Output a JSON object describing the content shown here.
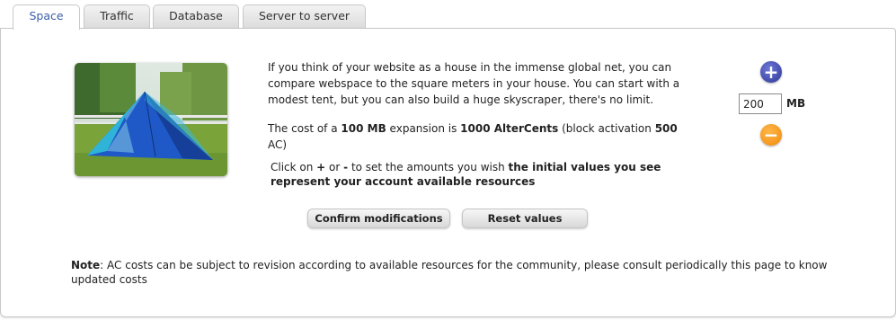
{
  "tabs": [
    {
      "label": "Space",
      "active": true
    },
    {
      "label": "Traffic",
      "active": false
    },
    {
      "label": "Database",
      "active": false
    },
    {
      "label": "Server to server",
      "active": false
    }
  ],
  "image": {
    "subject": "tent-icon"
  },
  "description": "If you think of your website as a house in the immense global net, you can compare webspace to the square meters in your house. You can start with a modest tent, but you can also build a huge skyscraper, there's no limit.",
  "cost": {
    "prefix": "The cost of a ",
    "amount": "100 MB",
    "mid": " expansion is ",
    "price": "1000 AlterCents",
    "block_prefix": " (block activation ",
    "block_value": "500",
    "suffix": "AC)"
  },
  "instructions": {
    "prefix": "Click on ",
    "plus": "+",
    "or": " or ",
    "minus": "-",
    "mid": " to set the amounts you wish ",
    "bold": "the initial values you see represent your account available resources"
  },
  "controls": {
    "plus_symbol": "+",
    "minus_symbol": "−",
    "value": "200",
    "unit": "MB"
  },
  "buttons": {
    "confirm": "Confirm modifications",
    "reset": "Reset values"
  },
  "note": {
    "label": "Note",
    "text": ": AC costs can be subject to revision according to available resources for the community, please consult periodically this page to know updated costs"
  },
  "colors": {
    "active_tab_text": "#3a5da8",
    "plus_button": "#3a44a8",
    "minus_button": "#f59a1b"
  }
}
